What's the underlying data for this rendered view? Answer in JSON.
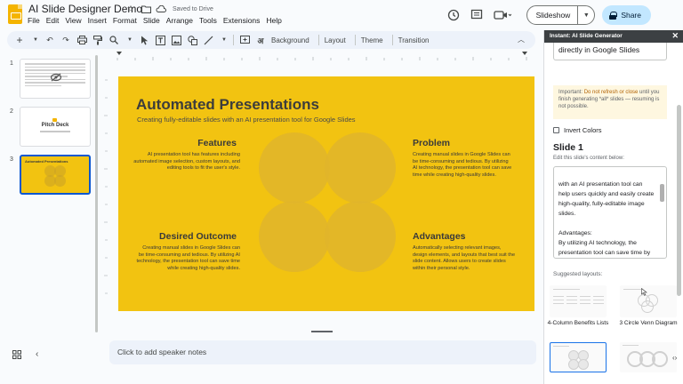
{
  "app": {
    "doc_title": "AI Slide Designer Demo",
    "saved_status": "Saved to Drive",
    "menu": [
      "File",
      "Edit",
      "View",
      "Insert",
      "Format",
      "Slide",
      "Arrange",
      "Tools",
      "Extensions",
      "Help"
    ],
    "slideshow_label": "Slideshow",
    "share_label": "Share"
  },
  "toolbar": {
    "background_label": "Background",
    "layout_label": "Layout",
    "theme_label": "Theme",
    "transition_label": "Transition"
  },
  "filmstrip": {
    "slides": [
      {
        "number": "1"
      },
      {
        "number": "2",
        "title": "Pitch Deck"
      },
      {
        "number": "3",
        "title": "Automated Presentations"
      }
    ]
  },
  "slide": {
    "title": "Automated Presentations",
    "subtitle": "Creating fully-editable slides with an AI presentation tool for Google Slides",
    "sections": {
      "features": {
        "heading": "Features",
        "body": "AI presentation tool has features including automated image selection, custom layouts, and editing tools to fit the user's style."
      },
      "problem": {
        "heading": "Problem",
        "body": "Creating manual slides in Google Slides can be time-consuming and tedious. By utilizing AI technology, the presentation tool can save time while creating high-quality slides."
      },
      "desired_outcome": {
        "heading": "Desired Outcome",
        "body": "Creating manual slides in Google Slides can be time-consuming and tedious. By utilizing AI technology, the presentation tool can save time while creating high-quality slides."
      },
      "advantages": {
        "heading": "Advantages",
        "body": "Automatically selecting relevant images, design elements, and layouts that best suit the slide content. Allows users to create slides within their personal style."
      }
    },
    "background_color": "#f2c311"
  },
  "notes": {
    "placeholder": "Click to add speaker notes"
  },
  "panel": {
    "header": "Instant: AI Slide Generator",
    "top_text": "directly in Google Slides",
    "warning_prefix": "Important: ",
    "warning_highlight": "Do not refresh or close",
    "warning_rest": " until you finish generating *all* slides — resuming is not possible.",
    "invert_label": "Invert Colors",
    "slide_heading": "Slide 1",
    "edit_label": "Edit this slide's content below:",
    "content": "with an AI presentation tool can help users quickly and easily create high-quality, fully-editable image slides.\n\nAdvantages:\nBy utilizing AI technology, the presentation tool can save time by automatically selecting relevant",
    "suggested_label": "Suggested layouts:",
    "layouts": [
      {
        "name": "4-Column Benefits Lists"
      },
      {
        "name": "3 Circle Venn Diagram"
      }
    ]
  },
  "colors": {
    "accent": "#0b57d0",
    "share_bg": "#c2e7ff",
    "slide_yellow": "#f2c311"
  }
}
